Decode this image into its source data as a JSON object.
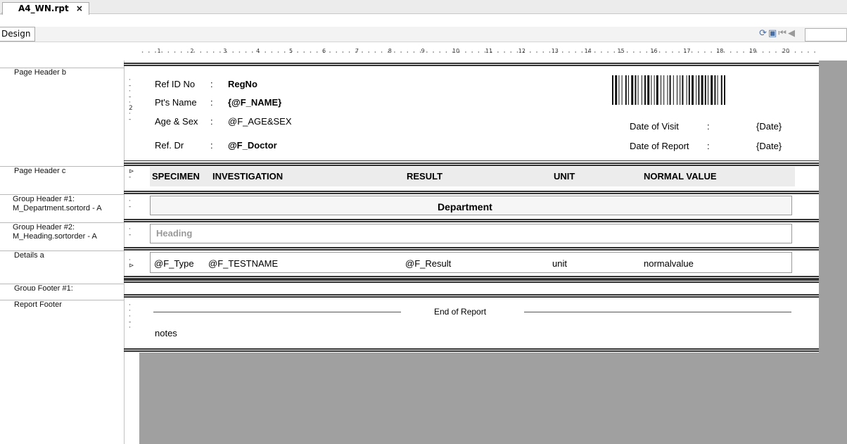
{
  "tab": {
    "title": "A4_WN.rpt",
    "close": "×"
  },
  "view_tab": "Design",
  "ruler": {
    "marks": [
      "1",
      "2",
      "3",
      "4",
      "5",
      "6",
      "7",
      "8",
      "9",
      "10",
      "11",
      "12",
      "13",
      "14",
      "15",
      "16",
      "17",
      "18",
      "19",
      "20"
    ]
  },
  "sections": [
    "Page Header b",
    "Page Header c",
    "Group Header #1:\nM_Department.sortord - A",
    "Group Header #2:\nM_Heading.sortorder - A",
    "Details a",
    "Group Footer #1:",
    "Report Footer"
  ],
  "page_header_b": {
    "ref_label": "Ref ID No",
    "ref_colon": ":",
    "ref_value": "RegNo",
    "name_label": "Pt's Name",
    "name_colon": ":",
    "name_value": "{@F_NAME}",
    "age_label": "Age & Sex",
    "age_colon": ":",
    "age_value": "@F_AGE&SEX",
    "dr_label": "Ref. Dr",
    "dr_colon": ":",
    "dr_value": "@F_Doctor",
    "visit_label": "Date of Visit",
    "visit_colon": ":",
    "visit_value": "{Date}",
    "report_label": "Date of Report",
    "report_colon": ":",
    "report_value": "{Date}"
  },
  "page_header_c": {
    "specimen": "SPECIMEN",
    "investigation": "INVESTIGATION",
    "result": "RESULT",
    "unit": "UNIT",
    "normal": "NORMAL VALUE"
  },
  "group1": {
    "department": "Department"
  },
  "group2": {
    "heading": "Heading"
  },
  "details": {
    "type": "@F_Type",
    "testname": "@F_TESTNAME",
    "result": "@F_Result",
    "unit": "unit",
    "normal": "normalvalue"
  },
  "report_footer": {
    "end": "End of Report",
    "notes": "notes"
  }
}
